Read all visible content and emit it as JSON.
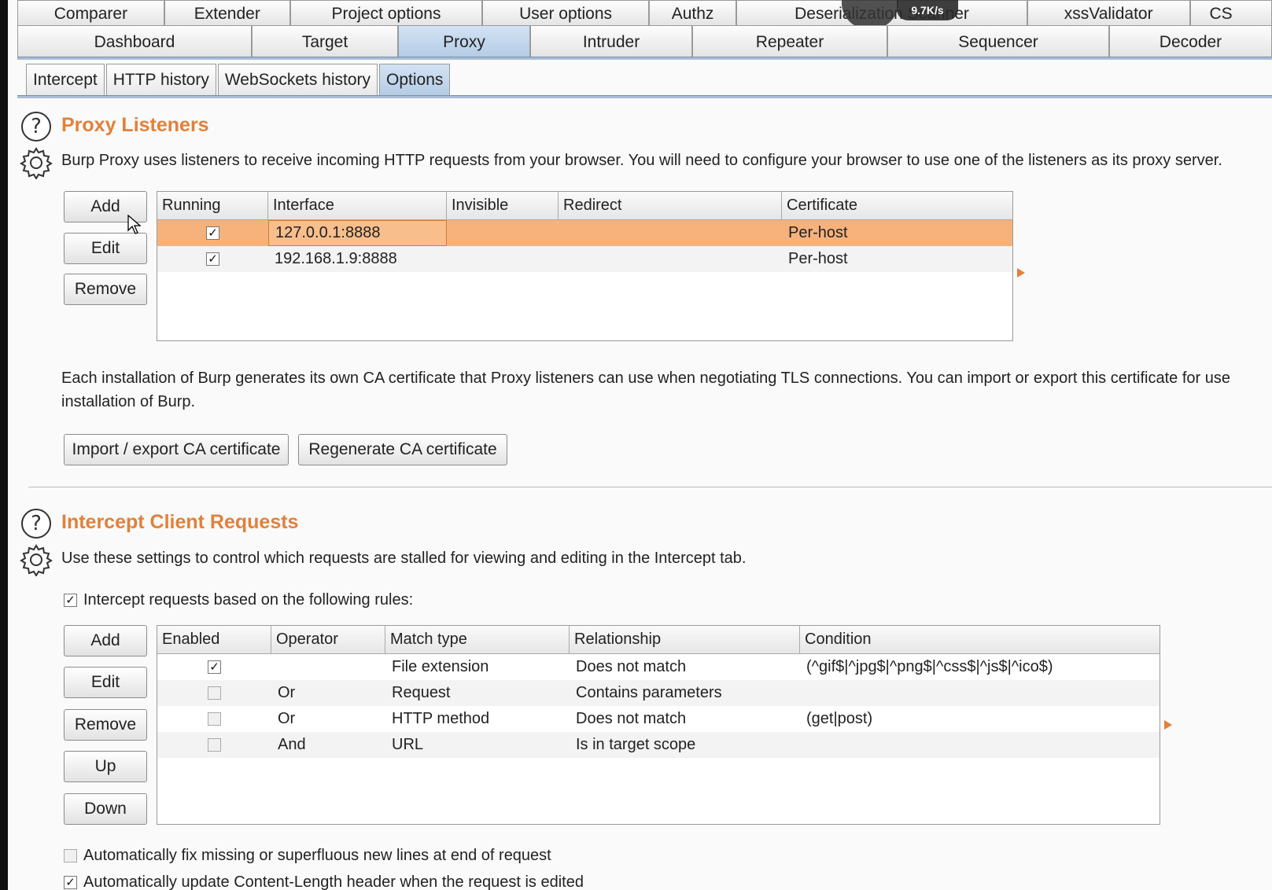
{
  "top_tabs_row1": [
    "Comparer",
    "Extender",
    "Project options",
    "User options",
    "Authz",
    "Deserialization Scanner",
    "xssValidator",
    "CS"
  ],
  "top_tabs_row2": [
    "Dashboard",
    "Target",
    "Proxy",
    "Intruder",
    "Repeater",
    "Sequencer",
    "Decoder"
  ],
  "active_top_tab": "Proxy",
  "sub_tabs": [
    "Intercept",
    "HTTP history",
    "WebSockets history",
    "Options"
  ],
  "active_sub_tab": "Options",
  "overlay": {
    "speed": "9.7K/s"
  },
  "listeners": {
    "title": "Proxy Listeners",
    "description": "Burp Proxy uses listeners to receive incoming HTTP requests from your browser. You will need to configure your browser to use one of the listeners as its proxy server.",
    "buttons": {
      "add": "Add",
      "edit": "Edit",
      "remove": "Remove"
    },
    "columns": [
      "Running",
      "Interface",
      "Invisible",
      "Redirect",
      "Certificate"
    ],
    "rows": [
      {
        "running": true,
        "interface": "127.0.0.1:8888",
        "invisible": "",
        "redirect": "",
        "certificate": "Per-host",
        "selected": true
      },
      {
        "running": true,
        "interface": "192.168.1.9:8888",
        "invisible": "",
        "redirect": "",
        "certificate": "Per-host",
        "selected": false
      }
    ],
    "ca_text_line1": "Each installation of Burp generates its own CA certificate that Proxy listeners can use when negotiating TLS connections. You can import or export this certificate for use",
    "ca_text_line2": "installation of Burp.",
    "import_export_label": "Import / export CA certificate",
    "regenerate_label": "Regenerate CA certificate"
  },
  "intercept": {
    "title": "Intercept Client Requests",
    "description": "Use these settings to control which requests are stalled for viewing and editing in the Intercept tab.",
    "rules_checkbox_label": "Intercept requests based on the following rules:",
    "rules_checked": true,
    "buttons": {
      "add": "Add",
      "edit": "Edit",
      "remove": "Remove",
      "up": "Up",
      "down": "Down"
    },
    "columns": [
      "Enabled",
      "Operator",
      "Match type",
      "Relationship",
      "Condition"
    ],
    "rows": [
      {
        "enabled": true,
        "operator": "",
        "match_type": "File extension",
        "relationship": "Does not match",
        "condition": "(^gif$|^jpg$|^png$|^css$|^js$|^ico$)"
      },
      {
        "enabled": false,
        "operator": "Or",
        "match_type": "Request",
        "relationship": "Contains parameters",
        "condition": ""
      },
      {
        "enabled": false,
        "operator": "Or",
        "match_type": "HTTP method",
        "relationship": "Does not match",
        "condition": "(get|post)"
      },
      {
        "enabled": false,
        "operator": "And",
        "match_type": "URL",
        "relationship": "Is in target scope",
        "condition": ""
      }
    ],
    "fix_newlines_label": "Automatically fix missing or superfluous new lines at end of request",
    "fix_newlines_checked": false,
    "update_length_label": "Automatically update Content-Length header when the request is edited",
    "update_length_checked": true
  }
}
